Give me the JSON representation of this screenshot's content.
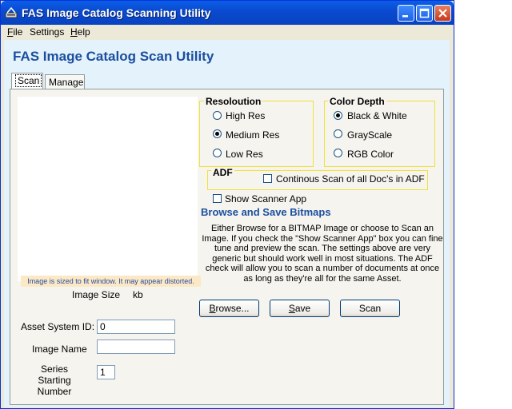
{
  "window": {
    "title": "FAS Image Catalog Scanning Utility"
  },
  "menu": {
    "file": "File",
    "settings": "Settings",
    "help": "Help"
  },
  "app_heading": "FAS Image Catalog Scan Utility",
  "tabs": [
    {
      "label": "Scan"
    },
    {
      "label": "Manage"
    }
  ],
  "image_panel": {
    "note": "Image is sized to fit window. It may appear distorted.",
    "size_label": "Image Size",
    "size_unit": "kb"
  },
  "form": {
    "asset_system_id_label": "Asset System ID:",
    "asset_system_id_value": "0",
    "image_name_label": "Image Name",
    "image_name_value": "",
    "series_label_line1": "Series Starting",
    "series_label_line2": "Number",
    "series_value": "1"
  },
  "resolution": {
    "title": "Resoloution",
    "options": [
      "High Res",
      "Medium Res",
      "Low Res"
    ],
    "selected": "Medium Res"
  },
  "color_depth": {
    "title": "Color Depth",
    "options": [
      "Black & White",
      "GrayScale",
      "RGB Color"
    ],
    "selected": "Black & White"
  },
  "adf": {
    "title": "ADF",
    "continuous_label": "Continous Scan of all Doc's in ADF",
    "continuous_checked": false
  },
  "show_scanner_app": {
    "label": "Show Scanner App",
    "checked": false
  },
  "browse_section": {
    "heading": "Browse and Save Bitmaps",
    "description": "Either Browse for a BITMAP Image or choose to Scan an Image. If you check the \"Show Scanner App\" box you can fine tune and preview the scan. The settings above are very generic but should work well in most situations. The ADF check will allow you to scan a number of documents at once as long as they're all for the same Asset."
  },
  "buttons": {
    "browse": "Browse...",
    "save": "Save",
    "scan": "Scan"
  },
  "colors": {
    "heading_blue": "#1c4fa0",
    "titlebar_blue": "#0a5fe8",
    "group_border": "#f0e040",
    "panel_bg": "#e3f2fb"
  }
}
